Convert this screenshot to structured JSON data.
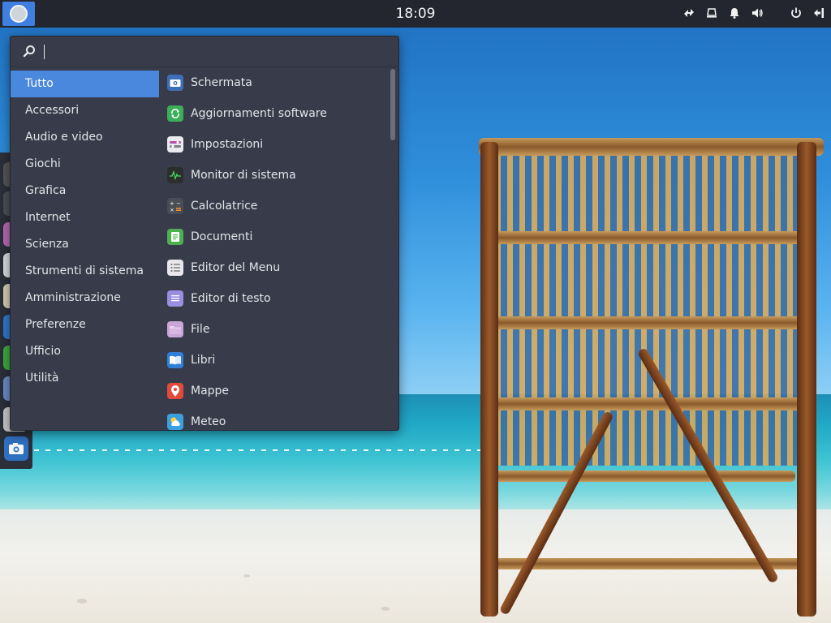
{
  "topbar": {
    "clock": "18:09",
    "tray_icons": [
      "network-icon",
      "display-icon",
      "notifications-icon",
      "volume-icon",
      "power-icon",
      "logout-icon"
    ]
  },
  "menu": {
    "search_value": "",
    "categories": [
      {
        "label": "Tutto",
        "active": true
      },
      {
        "label": "Accessori"
      },
      {
        "label": "Audio e video"
      },
      {
        "label": "Giochi"
      },
      {
        "label": "Grafica"
      },
      {
        "label": "Internet"
      },
      {
        "label": "Scienza"
      },
      {
        "label": "Strumenti di sistema"
      },
      {
        "label": "Amministrazione"
      },
      {
        "label": "Preferenze"
      },
      {
        "label": "Ufficio"
      },
      {
        "label": "Utilità"
      }
    ],
    "apps": [
      {
        "label": "Schermata",
        "icon": "screenshot-icon",
        "color": "#3d6fb8"
      },
      {
        "label": "Aggiornamenti software",
        "icon": "software-update-icon",
        "color": "#3aae58"
      },
      {
        "label": "Impostazioni",
        "icon": "settings-icon",
        "color": "#e9e9ee"
      },
      {
        "label": "Monitor di sistema",
        "icon": "system-monitor-icon",
        "color": "#2b2f2b"
      },
      {
        "label": "Calcolatrice",
        "icon": "calculator-icon",
        "color": "#4a4d55"
      },
      {
        "label": "Documenti",
        "icon": "documents-icon",
        "color": "#4caf50"
      },
      {
        "label": "Editor del Menu",
        "icon": "menu-editor-icon",
        "color": "#e8e8ec"
      },
      {
        "label": "Editor di testo",
        "icon": "text-editor-icon",
        "color": "#9a8ee0"
      },
      {
        "label": "File",
        "icon": "files-icon",
        "color": "#c9a6d8"
      },
      {
        "label": "Libri",
        "icon": "books-icon",
        "color": "#2f7fd8"
      },
      {
        "label": "Mappe",
        "icon": "maps-icon",
        "color": "#e24a3b"
      },
      {
        "label": "Meteo",
        "icon": "weather-icon",
        "color": "#3aa0e0"
      }
    ]
  },
  "colors": {
    "accent": "#4a88de",
    "panel": "#23262f",
    "menu_bg": "#383c4a"
  }
}
